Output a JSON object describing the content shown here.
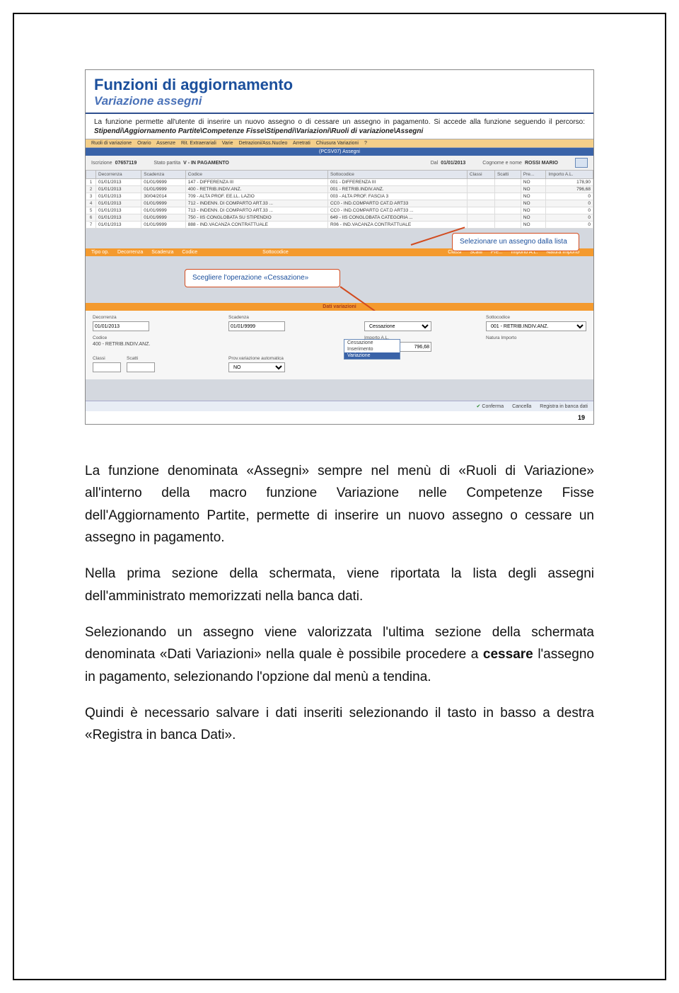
{
  "slide": {
    "title": "Funzioni di aggiornamento",
    "subtitle": "Variazione assegni",
    "intro_plain": "La funzione permette all'utente di inserire un nuovo assegno o di cessare un assegno in pagamento. Si accede alla funzione seguendo il percorso: ",
    "intro_bold": "Stipendi\\Aggiornamento Partite\\Competenze Fisse\\Stipendi\\Variazioni\\Ruoli di variazione\\Assegni",
    "page_number": "19"
  },
  "menubar": {
    "items": [
      "Ruoli di variazione",
      "Orario",
      "Assenze",
      "Rit. Extraerariali",
      "Varie",
      "Detrazioni/Ass.Nucleo",
      "Arretrati",
      "Chiusura Variazioni",
      "?"
    ]
  },
  "bluebar": "(PCSV07) Assegni",
  "header": {
    "iscrizione": "Iscrizione",
    "iscrizione_val": "07657119",
    "stato": "Stato partita",
    "stato_val": "V - IN PAGAMENTO",
    "dal": "Dal",
    "dal_val": "01/01/2013",
    "nome": "Cognome e nome",
    "nome_val": "ROSSI MARIO"
  },
  "grid": {
    "cols": [
      "Decorrenza",
      "Scadenza",
      "Codice",
      "",
      "Sottocodice",
      "",
      "Classi",
      "Scatti",
      "Pre...",
      "Importo A.L."
    ],
    "rows": [
      [
        "1",
        "01/01/2013",
        "01/01/9999",
        "147 - DIFFERENZA III",
        "",
        "001 - DIFFERENZA III",
        "",
        "",
        "",
        "NO",
        "178,90"
      ],
      [
        "2",
        "01/01/2013",
        "01/01/9999",
        "400 - RETRIB.INDIV.ANZ.",
        "",
        "001 - RETRIB.INDIV.ANZ.",
        "",
        "",
        "",
        "NO",
        "796,68"
      ],
      [
        "3",
        "01/01/2013",
        "30/04/2014",
        "709 - ALTA PROF. EE.LL. LAZIO",
        "",
        "003 - ALTA PROF. FASCIA 3",
        "",
        "",
        "",
        "NO",
        "0"
      ],
      [
        "4",
        "01/01/2013",
        "01/01/9999",
        "712 - INDENN. DI COMPARTO ART.33 ...",
        "",
        "CC0 - IND.COMPARTO CAT.D ART33",
        "",
        "",
        "",
        "NO",
        "0"
      ],
      [
        "5",
        "01/01/2013",
        "01/01/9999",
        "713 - INDENN. DI COMPARTO ART.33 ...",
        "",
        "CC0 - IND.COMPARTO CAT.D ART33 ...",
        "",
        "",
        "",
        "NO",
        "0"
      ],
      [
        "6",
        "01/01/2013",
        "01/01/9999",
        "750 - IIS CONGLOBATA SU STIPENDIO",
        "",
        "649 - IIS CONGLOBATA CATEGORIA ...",
        "",
        "",
        "",
        "NO",
        "0"
      ],
      [
        "7",
        "01/01/2013",
        "01/01/9999",
        "888 - IND.VACANZA CONTRATTUALE",
        "",
        "R06 - IND.VACANZA CONTRATTUALE",
        "",
        "",
        "",
        "NO",
        "0"
      ]
    ]
  },
  "tips": {
    "select": "Selezionare un assegno dalla lista",
    "choose": "Scegliere l'operazione «Cessazione»"
  },
  "confirmbar": [
    "Tipo op.",
    "Decorrenza",
    "Scadenza",
    "Codice",
    "Sottocodice",
    "Classi",
    "Scatti",
    "Pre...",
    "Importo A.L.",
    "Natura Importo"
  ],
  "varihdr": "Dati variazioni",
  "form": {
    "decorrenza_lbl": "Decorrenza",
    "decorrenza_val": "01/01/2013",
    "scadenza_lbl": "Scadenza",
    "scadenza_val": "01/01/9999",
    "codice_lbl": "Codice",
    "codice_val": "400 - RETRIB.INDIV.ANZ.",
    "sottocodice_lbl": "Sottocodice",
    "sottocodice_val": "001 - RETRIB.INDIV.ANZ.",
    "classi_lbl": "Classi",
    "scatti_lbl": "Scatti",
    "prov_lbl": "Prov.variazione automatica",
    "prov_val": "NO",
    "importo_lbl": "Importo A.L.",
    "importo_val": "796,68",
    "natura_lbl": "Natura Importo",
    "op_lbl": "",
    "op_selected": "Cessazione",
    "op_options": [
      "Cessazione",
      "Inserimento",
      "Variazione"
    ]
  },
  "footer": {
    "conferma": "Conferma",
    "cancella": "Cancella",
    "registra": "Registra in banca dati"
  },
  "body": {
    "p1": "La funzione denominata «Assegni» sempre nel menù di «Ruoli di Variazione» all'interno della macro funzione Variazione nelle Competenze Fisse dell'Aggiornamento Partite, permette di inserire un nuovo assegno o cessare un assegno in pagamento.",
    "p2": "Nella prima sezione della schermata, viene riportata la lista degli assegni dell'amministrato memorizzati nella banca dati.",
    "p3a": "Selezionando un assegno viene valorizzata l'ultima sezione della schermata denominata «Dati Variazioni» nella quale è possibile procedere a ",
    "p3b": "cessare",
    "p3c": " l'assegno in pagamento, selezionando l'opzione dal menù a tendina.",
    "p4": "Quindi è necessario salvare i dati inseriti selezionando il tasto in basso a destra «Registra in banca Dati»."
  }
}
